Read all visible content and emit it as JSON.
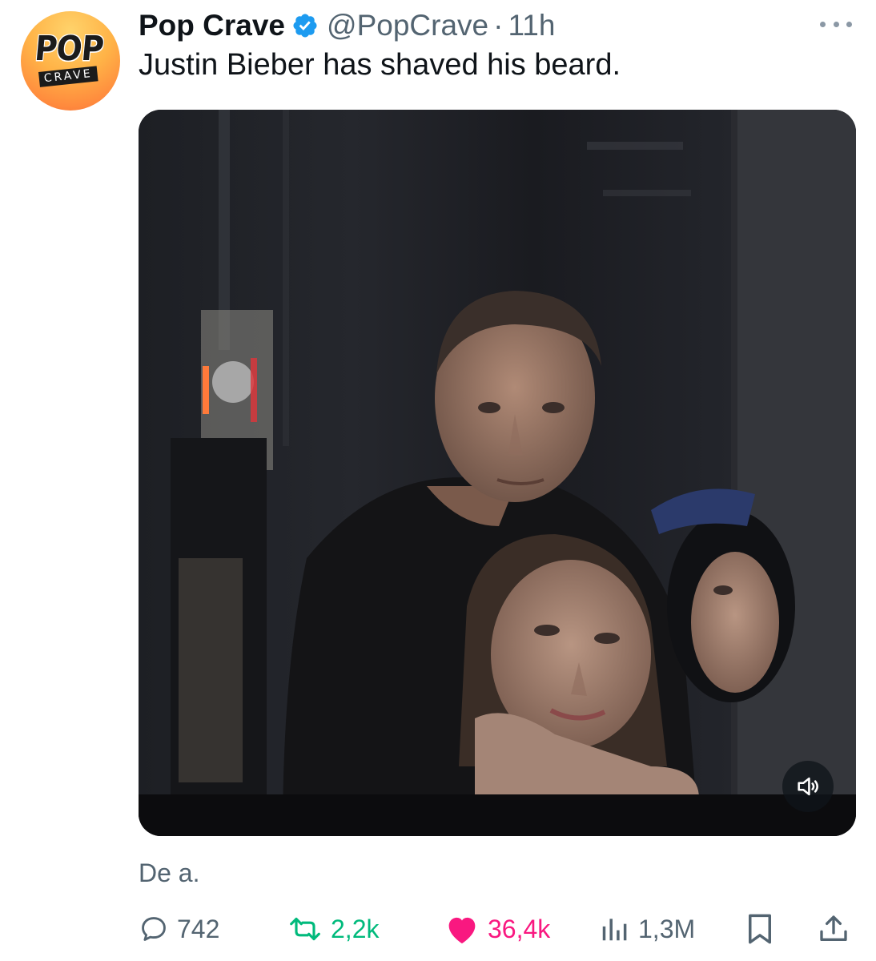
{
  "author": {
    "display_name": "Pop Crave",
    "handle": "@PopCrave",
    "separator": "·",
    "time": "11h",
    "verified": true,
    "avatar_text_top": "POP",
    "avatar_text_bottom": "CRAVE"
  },
  "tweet": {
    "text": "Justin Bieber has shaved his beard.",
    "caption": "De a."
  },
  "media": {
    "type": "video",
    "sound_icon": "speaker-muted-icon"
  },
  "stats": {
    "replies": "742",
    "retweets": "2,2k",
    "likes": "36,4k",
    "views": "1,3M"
  },
  "colors": {
    "verified": "#1d9bf0",
    "retweet": "#00ba7c",
    "like": "#f91880",
    "secondary_text": "#536471"
  },
  "icons": {
    "reply": "reply-bubble-icon",
    "retweet": "retweet-arrows-icon",
    "like": "heart-filled-icon",
    "views": "views-bars-icon",
    "bookmark": "bookmark-icon",
    "share": "share-upload-icon",
    "more": "more-dots-icon"
  }
}
